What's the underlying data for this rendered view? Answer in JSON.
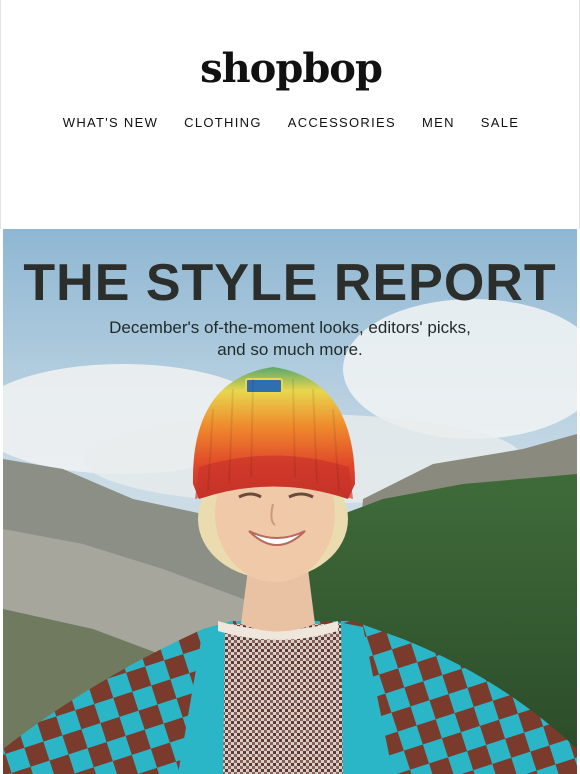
{
  "brand": {
    "logo_text": "shopbop"
  },
  "nav": {
    "items": [
      {
        "label": "WHAT'S NEW"
      },
      {
        "label": "CLOTHING"
      },
      {
        "label": "ACCESSORIES"
      },
      {
        "label": "MEN"
      },
      {
        "label": "SALE"
      }
    ]
  },
  "hero": {
    "title": "THE STYLE REPORT",
    "subtitle_line1": "December's of-the-moment looks, editors' picks,",
    "subtitle_line2": "and so much more."
  },
  "colors": {
    "title": "#2b2e2b",
    "sky": "#9fc3dc",
    "cardigan": "#2bb8c9",
    "check_dark": "#7a3a2b",
    "beanie": [
      "#f2d34a",
      "#e8832f",
      "#d94a2a",
      "#c23a2a"
    ]
  }
}
